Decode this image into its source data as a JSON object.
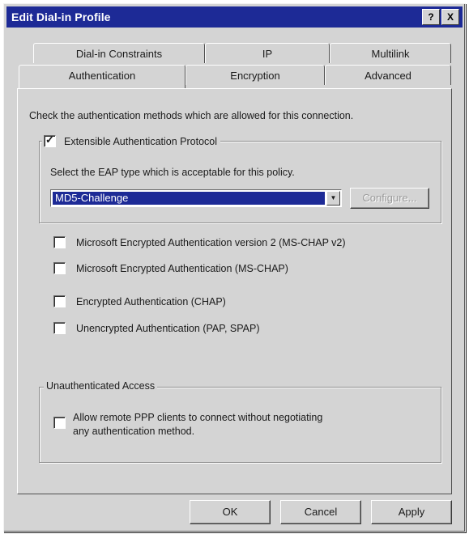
{
  "window": {
    "title": "Edit Dial-in Profile",
    "help_button": "?",
    "close_button": "X"
  },
  "tabs": {
    "row_back": [
      "Dial-in Constraints",
      "IP",
      "Multilink"
    ],
    "row_front": [
      "Authentication",
      "Encryption",
      "Advanced"
    ]
  },
  "auth": {
    "instruction": "Check the authentication methods which are allowed for this connection.",
    "eap": {
      "label": "Extensible Authentication Protocol",
      "checked": true,
      "select_prompt": "Select the EAP type which is acceptable for this policy.",
      "selected_value": "MD5-Challenge",
      "configure_label": "Configure..."
    },
    "methods": [
      {
        "label": "Microsoft Encrypted Authentication version 2 (MS-CHAP v2)",
        "checked": false
      },
      {
        "label": "Microsoft Encrypted Authentication (MS-CHAP)",
        "checked": false
      },
      {
        "label": "Encrypted Authentication (CHAP)",
        "checked": false
      },
      {
        "label": "Unencrypted Authentication (PAP, SPAP)",
        "checked": false
      }
    ],
    "unauth": {
      "legend": "Unauthenticated Access",
      "line1": "Allow remote PPP clients to connect without negotiating",
      "line2": "any authentication method.",
      "checked": false
    }
  },
  "buttons": {
    "ok": "OK",
    "cancel": "Cancel",
    "apply": "Apply"
  },
  "icons": {
    "checked": "checkmark-icon",
    "dropdown": "chevron-down-icon"
  }
}
